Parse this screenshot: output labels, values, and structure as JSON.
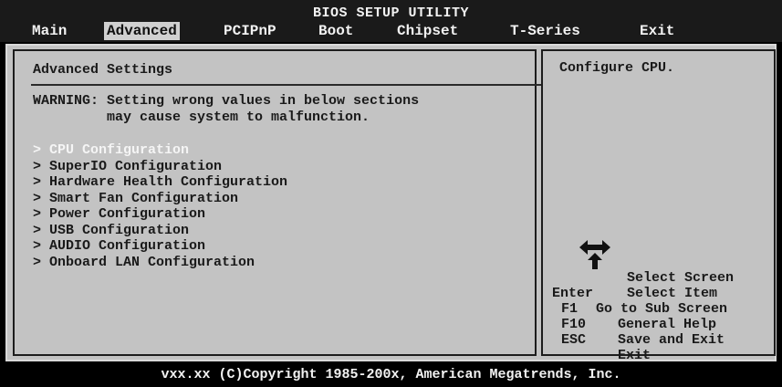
{
  "bios": {
    "title": "BIOS SETUP UTILITY",
    "menu": [
      "Main",
      "Advanced",
      "PCIPnP",
      "Boot",
      "Chipset",
      "T-Series",
      "Exit"
    ],
    "active_menu": "Advanced"
  },
  "left": {
    "title": "Advanced Settings",
    "warning_line1": "WARNING: Setting wrong values in below sections",
    "warning_line2": "         may cause system to malfunction.",
    "items": [
      "> CPU Configuration",
      "> SuperIO Configuration",
      "> Hardware Health Configuration",
      "> Smart Fan Configuration",
      "> Power Configuration",
      "> USB Configuration",
      "> AUDIO Configuration",
      "> Onboard LAN Configuration"
    ],
    "selected_index": 0
  },
  "right": {
    "help": "Configure CPU.",
    "keys": [
      {
        "key": "",
        "desc": "Select Screen"
      },
      {
        "key": "",
        "desc": "Select Item"
      },
      {
        "key": "Enter",
        "desc": "Go to Sub Screen"
      },
      {
        "key": "F1",
        "desc": "General Help"
      },
      {
        "key": "F10",
        "desc": "Save and Exit"
      },
      {
        "key": "ESC",
        "desc": "Exit"
      }
    ],
    "nav_icon": "arrow-keys-icon"
  },
  "footer": "vxx.xx (C)Copyright 1985-200x, American Megatrends, Inc.",
  "colors": {
    "background": "#000000",
    "panel": "#c3c3c3",
    "text_dark": "#1a1a1a",
    "text_light": "#f2f2f2"
  }
}
